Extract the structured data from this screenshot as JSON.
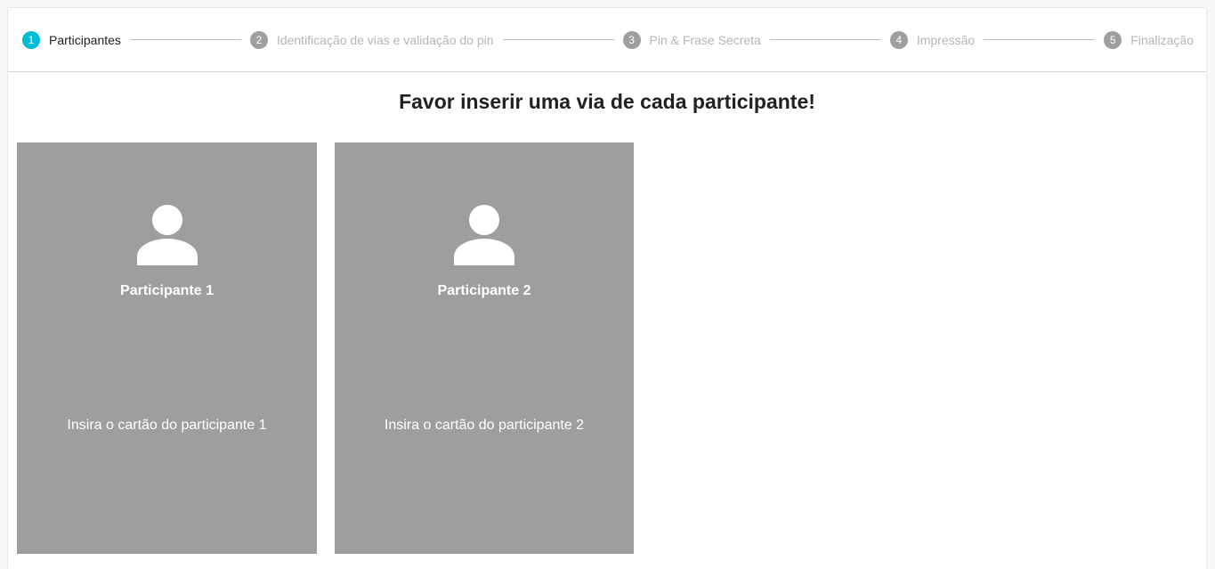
{
  "stepper": {
    "steps": [
      {
        "number": "1",
        "label": "Participantes",
        "active": true
      },
      {
        "number": "2",
        "label": "Identificação de vias e validação do pin",
        "active": false
      },
      {
        "number": "3",
        "label": "Pin & Frase Secreta",
        "active": false
      },
      {
        "number": "4",
        "label": "Impressão",
        "active": false
      },
      {
        "number": "5",
        "label": "Finalização",
        "active": false
      }
    ]
  },
  "main": {
    "heading": "Favor inserir uma via de cada participante!",
    "cards": [
      {
        "title": "Participante 1",
        "message": "Insira o cartão do participante 1",
        "icon": "person-icon"
      },
      {
        "title": "Participante 2",
        "message": "Insira o cartão do participante 2",
        "icon": "person-icon"
      }
    ]
  },
  "colors": {
    "accent": "#00bcd4",
    "inactive_step": "#9e9e9e",
    "card_background": "#9e9e9e",
    "card_text": "#ffffff"
  }
}
